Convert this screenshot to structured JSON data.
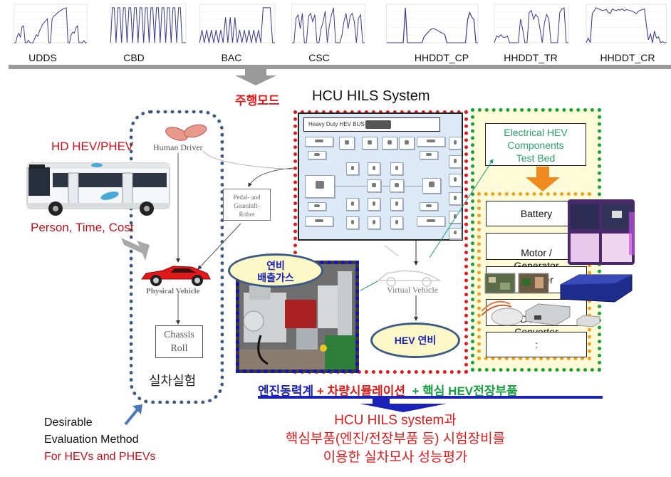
{
  "driving_cycles": [
    {
      "label": "UDDS",
      "profile": [
        0,
        0,
        12,
        18,
        10,
        30,
        32,
        0,
        0,
        5,
        0,
        0,
        0,
        8,
        15,
        12,
        22,
        28,
        35,
        38,
        42,
        45,
        0,
        0,
        45,
        50,
        52,
        55,
        58,
        60,
        62,
        64,
        65,
        66,
        0,
        0,
        15,
        20,
        18,
        28,
        32,
        0,
        0,
        0,
        4,
        0,
        0
      ]
    },
    {
      "label": "CBD",
      "profile": [
        0,
        32,
        32,
        0,
        32,
        32,
        0,
        32,
        32,
        0,
        32,
        32,
        0,
        32,
        32,
        0,
        32,
        32,
        0,
        32,
        32,
        0,
        32,
        32,
        0,
        32,
        32,
        0,
        32,
        32,
        0,
        32,
        32,
        0,
        32,
        32,
        0,
        32,
        32,
        0,
        0,
        0
      ]
    },
    {
      "label": "BAC",
      "profile": [
        0,
        20,
        0,
        20,
        0,
        20,
        0,
        20,
        0,
        20,
        0,
        40,
        0,
        40,
        0,
        40,
        0,
        20,
        0,
        20,
        0,
        20,
        0,
        20,
        0,
        20,
        0,
        55,
        55,
        55,
        55,
        0,
        0
      ]
    },
    {
      "label": "CSC",
      "profile": [
        0,
        0,
        35,
        40,
        20,
        42,
        0,
        0,
        38,
        42,
        30,
        40,
        0,
        0,
        20,
        30,
        45,
        0,
        25,
        40,
        50,
        0,
        0,
        0,
        10,
        30,
        42,
        20,
        38,
        42,
        30,
        0,
        35,
        40,
        0,
        0
      ]
    },
    {
      "label": "HHDDT_CP",
      "profile": [
        0,
        0,
        0,
        0,
        0,
        0,
        0,
        0,
        0,
        30,
        0,
        0,
        0,
        0,
        0,
        0,
        0,
        0,
        5,
        7,
        9,
        11,
        12,
        12,
        11,
        10,
        9,
        8,
        7,
        0,
        0,
        0,
        0,
        0,
        0,
        0,
        0,
        0,
        0,
        20,
        26,
        22,
        20,
        0,
        0
      ]
    },
    {
      "label": "HHDDT_TR",
      "profile": [
        0,
        10,
        8,
        12,
        8,
        8,
        10,
        0,
        0,
        0,
        0,
        0,
        35,
        20,
        0,
        0,
        45,
        48,
        35,
        42,
        38,
        20,
        0,
        30,
        42,
        35,
        0,
        0,
        0,
        0,
        45,
        50,
        52,
        0,
        0
      ]
    },
    {
      "label": "HHDDT_CR",
      "profile": [
        0,
        8,
        0,
        50,
        55,
        60,
        58,
        57,
        55,
        56,
        57,
        52,
        50,
        58,
        56,
        55,
        57,
        56,
        58,
        55,
        57,
        56,
        55,
        54,
        52,
        50,
        54,
        56,
        57,
        58,
        30,
        5,
        15,
        0,
        20,
        8,
        10,
        0,
        2,
        0,
        0
      ]
    }
  ],
  "header": {
    "driving_mode_kr": "주행모드",
    "hils_title": "HCU HILS System"
  },
  "left": {
    "hd_hev": "HD HEV/PHEV",
    "cost_note": "Person, Time, Cost",
    "human_driver": "Human Driver",
    "robot_lines": [
      "Pedal- and",
      "Gearshift-",
      "Robot"
    ],
    "physical_vehicle": "Physical Vehicle",
    "chassis_lines": [
      "Chassis",
      "Roll"
    ],
    "real_test_kr": "실차실험"
  },
  "hils": {
    "panel_title": "Heavy Duty HEV BUS",
    "virtual_vehicle": "Virtual Vehicle",
    "hev_fuel": "HEV 연비"
  },
  "engine": {
    "fuel_emission_lines": [
      "연비",
      "배출가스"
    ]
  },
  "electrical": {
    "title_lines": [
      "Electrical HEV",
      "Components",
      "Test Bed"
    ],
    "components": [
      "Battery",
      "Motor /\nGenerator",
      "Inverter",
      "DC-DC\nConverter",
      ":"
    ],
    "accent_green": "#2aa06a",
    "accent_orange": "#ef8a1e"
  },
  "bottom": {
    "part1": "엔진동력계",
    "part2": " + 차량시뮬레이션",
    "part3": "  + 핵심 HEV전장부품",
    "conclusion_lines": [
      "HCU HILS system과",
      "핵심부품(엔진/전장부품 등) 시험장비를",
      "이용한 실차모사 성능평가"
    ],
    "desirable_lines": [
      "Desirable",
      "Evaluation Method",
      "For HEVs and PHEVs"
    ]
  },
  "colors": {
    "red": "#e01a1a",
    "blue": "#1a22b8",
    "green": "#18a040",
    "steel": "#3b5b84",
    "cycle_line": "#3a3a8c"
  }
}
